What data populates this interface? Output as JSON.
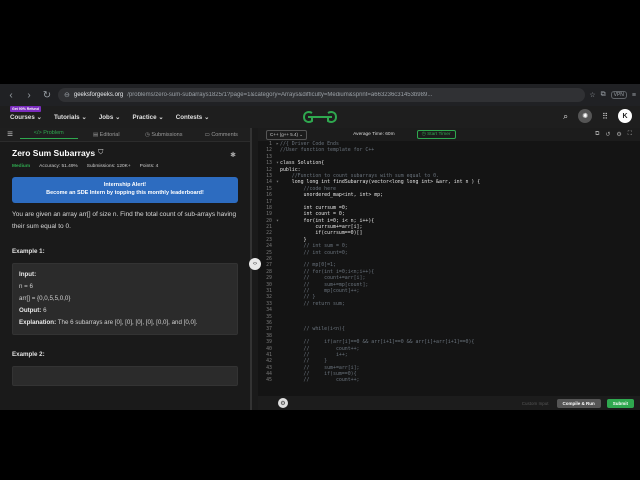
{
  "browser": {
    "url_domain": "geeksforgeeks.org",
    "url_path": "/problems/zero-sum-subarrays1825/1?page=1&category=Arrays&difficulty=Medium&sprint=a663236c31453b989...",
    "vpn_label": "VPN"
  },
  "header": {
    "promo_badge": "Get 90% Refund",
    "nav": [
      "Courses",
      "Tutorials",
      "Jobs",
      "Practice",
      "Contests"
    ],
    "avatar_initial": "K"
  },
  "tabs": [
    "Problem",
    "Editorial",
    "Submissions",
    "Comments"
  ],
  "problem": {
    "title": "Zero Sum Subarrays",
    "difficulty": "Medium",
    "accuracy": "Accuracy: 51.49%",
    "submissions": "Submissions: 120K+",
    "points": "Points: 4",
    "alert_line1": "Internship Alert!",
    "alert_line2": "Become an SDE Intern by topping this monthly leaderboard!",
    "description": "You are given an array arr[] of size n. Find the total count of sub-arrays having their sum equal to 0.",
    "example1_label": "Example 1:",
    "example1": {
      "input_label": "Input:",
      "n": "n = 6",
      "arr": "arr[] = {0,0,5,5,0,0}",
      "output_label": "Output:",
      "output_value": "6",
      "explanation_label": "Explanation:",
      "explanation_text": "The 6 subarrays are [0], [0], [0], [0], [0,0], and [0,0]."
    },
    "example2_label": "Example 2:"
  },
  "editor": {
    "language": "C++ (g++ 5.4)",
    "avg_time": "Average Time: 60m",
    "timer_label": "Start Timer",
    "custom_input": "Custom Input",
    "compile_label": "Compile & Run",
    "submit_label": "Submit",
    "lines": [
      {
        "n": "1",
        "t": "//{ Driver Code Ends",
        "c": "com",
        "a": "▸"
      },
      {
        "n": "12",
        "t": "//User function template for C++",
        "c": "com",
        "a": ""
      },
      {
        "n": "13",
        "t": "",
        "c": "",
        "a": ""
      },
      {
        "n": "13",
        "t": "class Solution{",
        "c": "",
        "a": "▾"
      },
      {
        "n": "12",
        "t": "public:",
        "c": "",
        "a": ""
      },
      {
        "n": "13",
        "t": "    //Function to count subarrays with sum equal to 0.",
        "c": "com",
        "a": ""
      },
      {
        "n": "14",
        "t": "    long long int findSubarray(vector<long long int> &arr, int n ) {",
        "c": "",
        "a": "▾"
      },
      {
        "n": "15",
        "t": "        //code here",
        "c": "com",
        "a": ""
      },
      {
        "n": "16",
        "t": "        unordered_map<int, int> mp;",
        "c": "",
        "a": ""
      },
      {
        "n": "17",
        "t": "",
        "c": "",
        "a": ""
      },
      {
        "n": "18",
        "t": "        int currsum =0;",
        "c": "",
        "a": ""
      },
      {
        "n": "19",
        "t": "        int count = 0;",
        "c": "",
        "a": ""
      },
      {
        "n": "20",
        "t": "        for(int i=0; i< n; i++){",
        "c": "",
        "a": "▾"
      },
      {
        "n": "21",
        "t": "            currsum+=arr[i];",
        "c": "",
        "a": ""
      },
      {
        "n": "22",
        "t": "            if(currsum==0)[]",
        "c": "",
        "a": ""
      },
      {
        "n": "23",
        "t": "        }",
        "c": "",
        "a": ""
      },
      {
        "n": "24",
        "t": "        // int sum = 0;",
        "c": "com",
        "a": ""
      },
      {
        "n": "25",
        "t": "        // int count=0;",
        "c": "com",
        "a": ""
      },
      {
        "n": "26",
        "t": "",
        "c": "",
        "a": ""
      },
      {
        "n": "27",
        "t": "        // mp[0]=1;",
        "c": "com",
        "a": ""
      },
      {
        "n": "28",
        "t": "        // for(int i=0;i<n;i++){",
        "c": "com",
        "a": ""
      },
      {
        "n": "29",
        "t": "        //     count+=arr[i];",
        "c": "com",
        "a": ""
      },
      {
        "n": "30",
        "t": "        //     sum+=mp[count];",
        "c": "com",
        "a": ""
      },
      {
        "n": "31",
        "t": "        //     mp[count]++;",
        "c": "com",
        "a": ""
      },
      {
        "n": "32",
        "t": "        // }",
        "c": "com",
        "a": ""
      },
      {
        "n": "33",
        "t": "        // return sum;",
        "c": "com",
        "a": ""
      },
      {
        "n": "34",
        "t": "",
        "c": "",
        "a": ""
      },
      {
        "n": "35",
        "t": "",
        "c": "",
        "a": ""
      },
      {
        "n": "36",
        "t": "",
        "c": "",
        "a": ""
      },
      {
        "n": "37",
        "t": "        // while(i<n){",
        "c": "com",
        "a": ""
      },
      {
        "n": "38",
        "t": "",
        "c": "",
        "a": ""
      },
      {
        "n": "39",
        "t": "        //     if(arr[i]==0 && arr[i+1]==0 && arr[i]+arr[i+1]==0){",
        "c": "com",
        "a": ""
      },
      {
        "n": "40",
        "t": "        //         count++;",
        "c": "com",
        "a": ""
      },
      {
        "n": "41",
        "t": "        //         i++;",
        "c": "com",
        "a": ""
      },
      {
        "n": "42",
        "t": "        //     }",
        "c": "com",
        "a": ""
      },
      {
        "n": "43",
        "t": "        //     sum+=arr[i];",
        "c": "com",
        "a": ""
      },
      {
        "n": "44",
        "t": "        //     if(sum==0){",
        "c": "com",
        "a": ""
      },
      {
        "n": "45",
        "t": "        //         count++;",
        "c": "com",
        "a": ""
      }
    ]
  }
}
